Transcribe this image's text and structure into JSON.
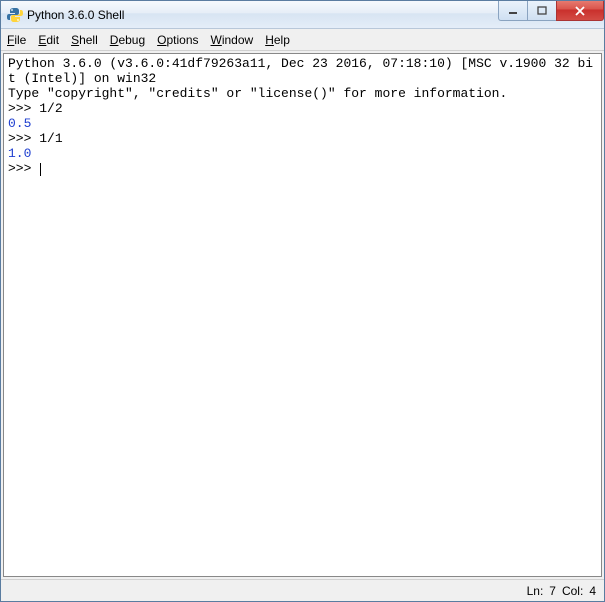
{
  "window": {
    "title": "Python 3.6.0 Shell"
  },
  "menu": {
    "file": "File",
    "edit": "Edit",
    "shell": "Shell",
    "debug": "Debug",
    "options": "Options",
    "window": "Window",
    "help": "Help"
  },
  "shell": {
    "banner_line1": "Python 3.6.0 (v3.6.0:41df79263a11, Dec 23 2016, 07:18:10) [MSC v.1900 32 bit (Intel)] on win32",
    "banner_line2": "Type \"copyright\", \"credits\" or \"license()\" for more information.",
    "prompt": ">>> ",
    "entries": [
      {
        "input": "1/2",
        "output": "0.5"
      },
      {
        "input": "1/1",
        "output": "1.0"
      }
    ]
  },
  "status": {
    "line_label": "Ln:",
    "line": "7",
    "col_label": "Col:",
    "col": "4"
  }
}
